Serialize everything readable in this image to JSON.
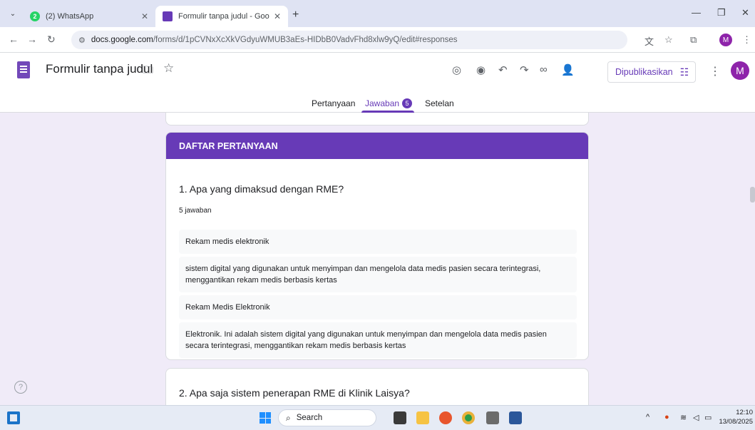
{
  "browser": {
    "tabs": [
      {
        "title": "(2) WhatsApp",
        "badge": "2"
      },
      {
        "title": "Formulir tanpa judul - Google F"
      }
    ],
    "new_tab_label": "+",
    "url_host": "docs.google.com",
    "url_path": "/forms/d/1pCVNxXcXkVGdyuWMUB3aEs-HIDbB0VadvFhd8xlw9yQ/edit#responses",
    "profile_initial": "M"
  },
  "form": {
    "title": "Formulir tanpa judul",
    "publish_label": "Dipublikasikan",
    "avatar_initial": "M",
    "tabs": {
      "questions": "Pertanyaan",
      "responses": "Jawaban",
      "responses_count": "5",
      "settings": "Setelan"
    }
  },
  "section": {
    "header": "DAFTAR PERTANYAAN"
  },
  "question1": {
    "title": "1. Apa yang dimaksud dengan RME?",
    "count_label": "5 jawaban",
    "answers": [
      "Rekam medis elektronik",
      "sistem digital yang digunakan untuk menyimpan dan mengelola data medis pasien secara terintegrasi, menggantikan rekam medis berbasis kertas",
      "Rekam Medis Elektronik",
      "Elektronik. Ini adalah sistem digital yang digunakan untuk menyimpan dan mengelola data medis pasien secara terintegrasi, menggantikan rekam medis berbasis kertas"
    ]
  },
  "question2": {
    "title": "2. Apa saja sistem penerapan RME di Klinik Laisya?"
  },
  "taskbar": {
    "search_label": "Search",
    "time": "12:10",
    "date": "13/08/2025"
  },
  "colors": {
    "accent": "#673ab7",
    "background": "#f0ebf8"
  }
}
